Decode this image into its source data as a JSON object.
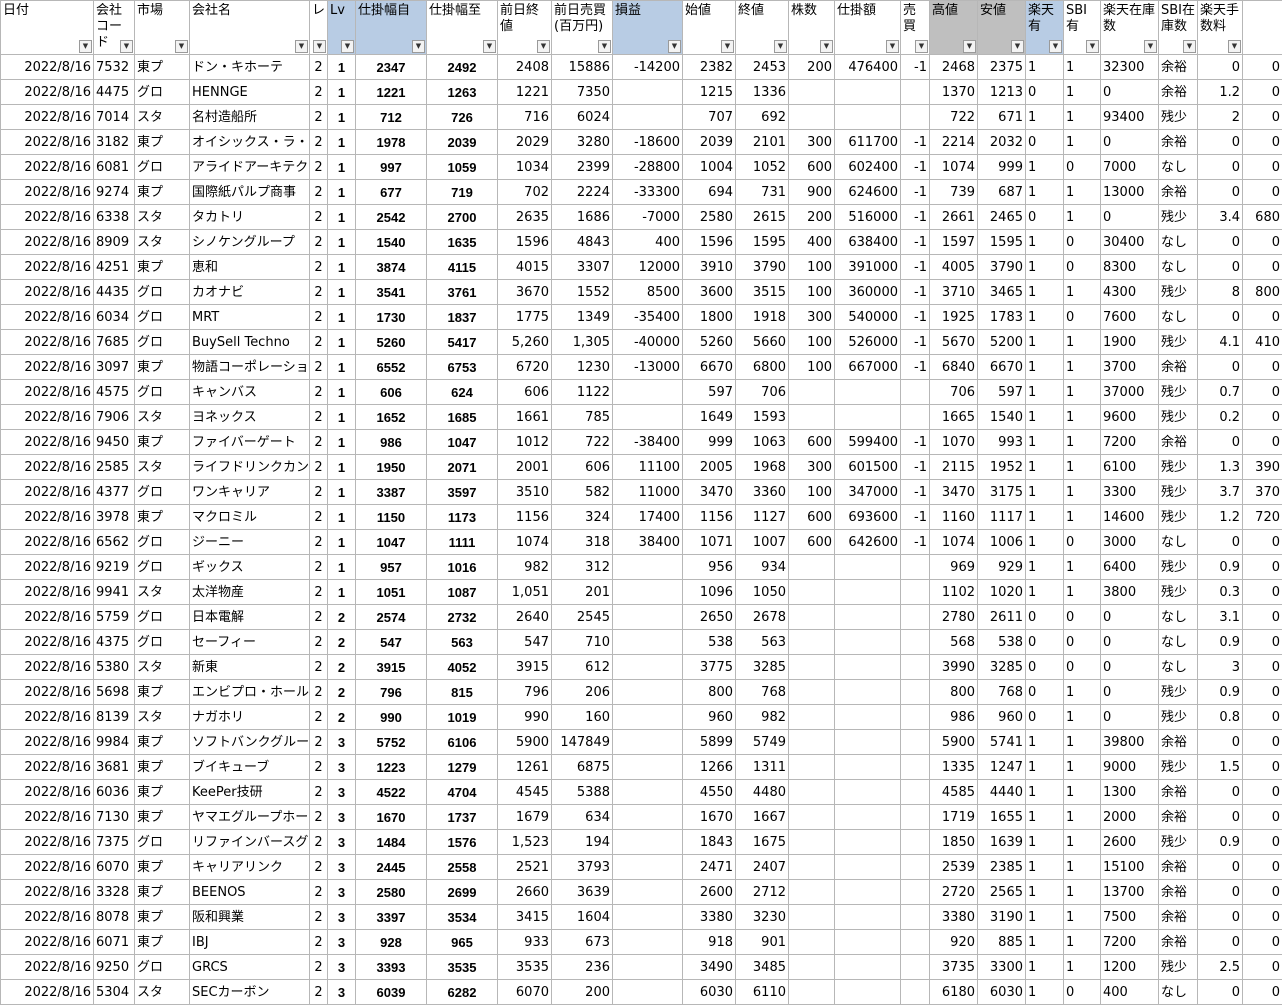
{
  "headers": [
    {
      "label": "日付",
      "style": ""
    },
    {
      "label": "会社コード",
      "style": ""
    },
    {
      "label": "市場",
      "style": ""
    },
    {
      "label": "会社名",
      "style": ""
    },
    {
      "label": "レ",
      "style": ""
    },
    {
      "label": "Lv",
      "style": "lv"
    },
    {
      "label": "仕掛幅自",
      "style": "blue"
    },
    {
      "label": "仕掛幅至",
      "style": ""
    },
    {
      "label": "前日終値",
      "style": ""
    },
    {
      "label": "前日売買(百万円)",
      "style": ""
    },
    {
      "label": "損益",
      "style": "blue"
    },
    {
      "label": "始値",
      "style": ""
    },
    {
      "label": "終値",
      "style": ""
    },
    {
      "label": "株数",
      "style": ""
    },
    {
      "label": "仕掛額",
      "style": ""
    },
    {
      "label": "売買",
      "style": ""
    },
    {
      "label": "高値",
      "style": "gray"
    },
    {
      "label": "安値",
      "style": "gray"
    },
    {
      "label": "楽天有",
      "style": "blue"
    },
    {
      "label": "SBI有",
      "style": ""
    },
    {
      "label": "楽天在庫数",
      "style": ""
    },
    {
      "label": "SBI在庫数",
      "style": ""
    },
    {
      "label": "楽天手数料",
      "style": ""
    },
    {
      "label": "",
      "style": ""
    }
  ],
  "rows": [
    [
      "2022/8/16",
      "7532",
      "東プ",
      "ドン・キホーテ",
      "2",
      "1",
      "2347",
      "2492",
      "2408",
      "15886",
      "-14200",
      "2382",
      "2453",
      "200",
      "476400",
      "-1",
      "2468",
      "2375",
      "1",
      "1",
      "32300",
      "余裕",
      "0",
      "0"
    ],
    [
      "2022/8/16",
      "4475",
      "グロ",
      "HENNGE",
      "2",
      "1",
      "1221",
      "1263",
      "1221",
      "7350",
      "",
      "1215",
      "1336",
      "",
      "",
      "",
      "1370",
      "1213",
      "0",
      "1",
      "0",
      "余裕",
      "1.2",
      "0"
    ],
    [
      "2022/8/16",
      "7014",
      "スタ",
      "名村造船所",
      "2",
      "1",
      "712",
      "726",
      "716",
      "6024",
      "",
      "707",
      "692",
      "",
      "",
      "",
      "722",
      "671",
      "1",
      "1",
      "93400",
      "残少",
      "2",
      "0"
    ],
    [
      "2022/8/16",
      "3182",
      "東プ",
      "オイシックス・ラ・大",
      "2",
      "1",
      "1978",
      "2039",
      "2029",
      "3280",
      "-18600",
      "2039",
      "2101",
      "300",
      "611700",
      "-1",
      "2214",
      "2032",
      "0",
      "1",
      "0",
      "余裕",
      "0",
      "0"
    ],
    [
      "2022/8/16",
      "6081",
      "グロ",
      "アライドアーキテク",
      "2",
      "1",
      "997",
      "1059",
      "1034",
      "2399",
      "-28800",
      "1004",
      "1052",
      "600",
      "602400",
      "-1",
      "1074",
      "999",
      "1",
      "0",
      "7000",
      "なし",
      "0",
      "0"
    ],
    [
      "2022/8/16",
      "9274",
      "東プ",
      "国際紙パルプ商事",
      "2",
      "1",
      "677",
      "719",
      "702",
      "2224",
      "-33300",
      "694",
      "731",
      "900",
      "624600",
      "-1",
      "739",
      "687",
      "1",
      "1",
      "13000",
      "余裕",
      "0",
      "0"
    ],
    [
      "2022/8/16",
      "6338",
      "スタ",
      "タカトリ",
      "2",
      "1",
      "2542",
      "2700",
      "2635",
      "1686",
      "-7000",
      "2580",
      "2615",
      "200",
      "516000",
      "-1",
      "2661",
      "2465",
      "0",
      "1",
      "0",
      "残少",
      "3.4",
      "680"
    ],
    [
      "2022/8/16",
      "8909",
      "スタ",
      "シノケングループ",
      "2",
      "1",
      "1540",
      "1635",
      "1596",
      "4843",
      "400",
      "1596",
      "1595",
      "400",
      "638400",
      "-1",
      "1597",
      "1595",
      "1",
      "0",
      "30400",
      "なし",
      "0",
      "0"
    ],
    [
      "2022/8/16",
      "4251",
      "東プ",
      "恵和",
      "2",
      "1",
      "3874",
      "4115",
      "4015",
      "3307",
      "12000",
      "3910",
      "3790",
      "100",
      "391000",
      "-1",
      "4005",
      "3790",
      "1",
      "0",
      "8300",
      "なし",
      "0",
      "0"
    ],
    [
      "2022/8/16",
      "4435",
      "グロ",
      "カオナビ",
      "2",
      "1",
      "3541",
      "3761",
      "3670",
      "1552",
      "8500",
      "3600",
      "3515",
      "100",
      "360000",
      "-1",
      "3710",
      "3465",
      "1",
      "1",
      "4300",
      "残少",
      "8",
      "800"
    ],
    [
      "2022/8/16",
      "6034",
      "グロ",
      "MRT",
      "2",
      "1",
      "1730",
      "1837",
      "1775",
      "1349",
      "-35400",
      "1800",
      "1918",
      "300",
      "540000",
      "-1",
      "1925",
      "1783",
      "1",
      "0",
      "7600",
      "なし",
      "0",
      "0"
    ],
    [
      "2022/8/16",
      "7685",
      "グロ",
      "BuySell Techno",
      "2",
      "1",
      "5260",
      "5417",
      "5,260",
      "1,305",
      "-40000",
      "5260",
      "5660",
      "100",
      "526000",
      "-1",
      "5670",
      "5200",
      "1",
      "1",
      "1900",
      "残少",
      "4.1",
      "410"
    ],
    [
      "2022/8/16",
      "3097",
      "東プ",
      "物語コーポレーショ",
      "2",
      "1",
      "6552",
      "6753",
      "6720",
      "1230",
      "-13000",
      "6670",
      "6800",
      "100",
      "667000",
      "-1",
      "6840",
      "6670",
      "1",
      "1",
      "3700",
      "余裕",
      "0",
      "0"
    ],
    [
      "2022/8/16",
      "4575",
      "グロ",
      "キャンバス",
      "2",
      "1",
      "606",
      "624",
      "606",
      "1122",
      "",
      "597",
      "706",
      "",
      "",
      "",
      "706",
      "597",
      "1",
      "1",
      "37000",
      "残少",
      "0.7",
      "0"
    ],
    [
      "2022/8/16",
      "7906",
      "スタ",
      "ヨネックス",
      "2",
      "1",
      "1652",
      "1685",
      "1661",
      "785",
      "",
      "1649",
      "1593",
      "",
      "",
      "",
      "1665",
      "1540",
      "1",
      "1",
      "9600",
      "残少",
      "0.2",
      "0"
    ],
    [
      "2022/8/16",
      "9450",
      "東プ",
      "ファイバーゲート",
      "2",
      "1",
      "986",
      "1047",
      "1012",
      "722",
      "-38400",
      "999",
      "1063",
      "600",
      "599400",
      "-1",
      "1070",
      "993",
      "1",
      "1",
      "7200",
      "余裕",
      "0",
      "0"
    ],
    [
      "2022/8/16",
      "2585",
      "スタ",
      "ライフドリンクカンパ",
      "2",
      "1",
      "1950",
      "2071",
      "2001",
      "606",
      "11100",
      "2005",
      "1968",
      "300",
      "601500",
      "-1",
      "2115",
      "1952",
      "1",
      "1",
      "6100",
      "残少",
      "1.3",
      "390"
    ],
    [
      "2022/8/16",
      "4377",
      "グロ",
      "ワンキャリア",
      "2",
      "1",
      "3387",
      "3597",
      "3510",
      "582",
      "11000",
      "3470",
      "3360",
      "100",
      "347000",
      "-1",
      "3470",
      "3175",
      "1",
      "1",
      "3300",
      "残少",
      "3.7",
      "370"
    ],
    [
      "2022/8/16",
      "3978",
      "東プ",
      "マクロミル",
      "2",
      "1",
      "1150",
      "1173",
      "1156",
      "324",
      "17400",
      "1156",
      "1127",
      "600",
      "693600",
      "-1",
      "1160",
      "1117",
      "1",
      "1",
      "14600",
      "残少",
      "1.2",
      "720"
    ],
    [
      "2022/8/16",
      "6562",
      "グロ",
      "ジーニー",
      "2",
      "1",
      "1047",
      "1111",
      "1074",
      "318",
      "38400",
      "1071",
      "1007",
      "600",
      "642600",
      "-1",
      "1074",
      "1006",
      "1",
      "0",
      "3000",
      "なし",
      "0",
      "0"
    ],
    [
      "2022/8/16",
      "9219",
      "グロ",
      "ギックス",
      "2",
      "1",
      "957",
      "1016",
      "982",
      "312",
      "",
      "956",
      "934",
      "",
      "",
      "",
      "969",
      "929",
      "1",
      "1",
      "6400",
      "残少",
      "0.9",
      "0"
    ],
    [
      "2022/8/16",
      "9941",
      "スタ",
      "太洋物産",
      "2",
      "1",
      "1051",
      "1087",
      "1,051",
      "201",
      "",
      "1096",
      "1050",
      "",
      "",
      "",
      "1102",
      "1020",
      "1",
      "1",
      "3800",
      "残少",
      "0.3",
      "0"
    ],
    [
      "2022/8/16",
      "5759",
      "グロ",
      "日本電解",
      "2",
      "2",
      "2574",
      "2732",
      "2640",
      "2545",
      "",
      "2650",
      "2678",
      "",
      "",
      "",
      "2780",
      "2611",
      "0",
      "0",
      "0",
      "なし",
      "3.1",
      "0"
    ],
    [
      "2022/8/16",
      "4375",
      "グロ",
      "セーフィー",
      "2",
      "2",
      "547",
      "563",
      "547",
      "710",
      "",
      "538",
      "563",
      "",
      "",
      "",
      "568",
      "538",
      "0",
      "0",
      "0",
      "なし",
      "0.9",
      "0"
    ],
    [
      "2022/8/16",
      "5380",
      "スタ",
      "新東",
      "2",
      "2",
      "3915",
      "4052",
      "3915",
      "612",
      "",
      "3775",
      "3285",
      "",
      "",
      "",
      "3990",
      "3285",
      "0",
      "0",
      "0",
      "なし",
      "3",
      "0"
    ],
    [
      "2022/8/16",
      "5698",
      "東プ",
      "エンビプロ・ホール",
      "2",
      "2",
      "796",
      "815",
      "796",
      "206",
      "",
      "800",
      "768",
      "",
      "",
      "",
      "800",
      "768",
      "0",
      "1",
      "0",
      "残少",
      "0.9",
      "0"
    ],
    [
      "2022/8/16",
      "8139",
      "スタ",
      "ナガホリ",
      "2",
      "2",
      "990",
      "1019",
      "990",
      "160",
      "",
      "960",
      "982",
      "",
      "",
      "",
      "986",
      "960",
      "0",
      "1",
      "0",
      "残少",
      "0.8",
      "0"
    ],
    [
      "2022/8/16",
      "9984",
      "東プ",
      "ソフトバンクグルー",
      "2",
      "3",
      "5752",
      "6106",
      "5900",
      "147849",
      "",
      "5899",
      "5749",
      "",
      "",
      "",
      "5900",
      "5741",
      "1",
      "1",
      "39800",
      "余裕",
      "0",
      "0"
    ],
    [
      "2022/8/16",
      "3681",
      "東プ",
      "ブイキューブ",
      "2",
      "3",
      "1223",
      "1279",
      "1261",
      "6875",
      "",
      "1266",
      "1311",
      "",
      "",
      "",
      "1335",
      "1247",
      "1",
      "1",
      "9000",
      "残少",
      "1.5",
      "0"
    ],
    [
      "2022/8/16",
      "6036",
      "東プ",
      "KeePer技研",
      "2",
      "3",
      "4522",
      "4704",
      "4545",
      "5388",
      "",
      "4550",
      "4480",
      "",
      "",
      "",
      "4585",
      "4440",
      "1",
      "1",
      "1300",
      "余裕",
      "0",
      "0"
    ],
    [
      "2022/8/16",
      "7130",
      "東プ",
      "ヤマエグループホー",
      "2",
      "3",
      "1670",
      "1737",
      "1679",
      "634",
      "",
      "1670",
      "1667",
      "",
      "",
      "",
      "1719",
      "1655",
      "1",
      "1",
      "2000",
      "余裕",
      "0",
      "0"
    ],
    [
      "2022/8/16",
      "7375",
      "グロ",
      "リファインバースグ",
      "2",
      "3",
      "1484",
      "1576",
      "1,523",
      "194",
      "",
      "1843",
      "1675",
      "",
      "",
      "",
      "1850",
      "1639",
      "1",
      "1",
      "2600",
      "残少",
      "0.9",
      "0"
    ],
    [
      "2022/8/16",
      "6070",
      "東プ",
      "キャリアリンク",
      "2",
      "3",
      "2445",
      "2558",
      "2521",
      "3793",
      "",
      "2471",
      "2407",
      "",
      "",
      "",
      "2539",
      "2385",
      "1",
      "1",
      "15100",
      "余裕",
      "0",
      "0"
    ],
    [
      "2022/8/16",
      "3328",
      "東プ",
      "BEENOS",
      "2",
      "3",
      "2580",
      "2699",
      "2660",
      "3639",
      "",
      "2600",
      "2712",
      "",
      "",
      "",
      "2720",
      "2565",
      "1",
      "1",
      "13700",
      "余裕",
      "0",
      "0"
    ],
    [
      "2022/8/16",
      "8078",
      "東プ",
      "阪和興業",
      "2",
      "3",
      "3397",
      "3534",
      "3415",
      "1604",
      "",
      "3380",
      "3230",
      "",
      "",
      "",
      "3380",
      "3190",
      "1",
      "1",
      "7500",
      "余裕",
      "0",
      "0"
    ],
    [
      "2022/8/16",
      "6071",
      "東プ",
      "IBJ",
      "2",
      "3",
      "928",
      "965",
      "933",
      "673",
      "",
      "918",
      "901",
      "",
      "",
      "",
      "920",
      "885",
      "1",
      "1",
      "7200",
      "余裕",
      "0",
      "0"
    ],
    [
      "2022/8/16",
      "9250",
      "グロ",
      "GRCS",
      "2",
      "3",
      "3393",
      "3535",
      "3535",
      "236",
      "",
      "3490",
      "3485",
      "",
      "",
      "",
      "3735",
      "3300",
      "1",
      "1",
      "1200",
      "残少",
      "2.5",
      "0"
    ],
    [
      "2022/8/16",
      "5304",
      "スタ",
      "SECカーボン",
      "2",
      "3",
      "6039",
      "6282",
      "6070",
      "200",
      "",
      "6030",
      "6110",
      "",
      "",
      "",
      "6180",
      "6030",
      "1",
      "0",
      "400",
      "なし",
      "0",
      "0"
    ]
  ]
}
